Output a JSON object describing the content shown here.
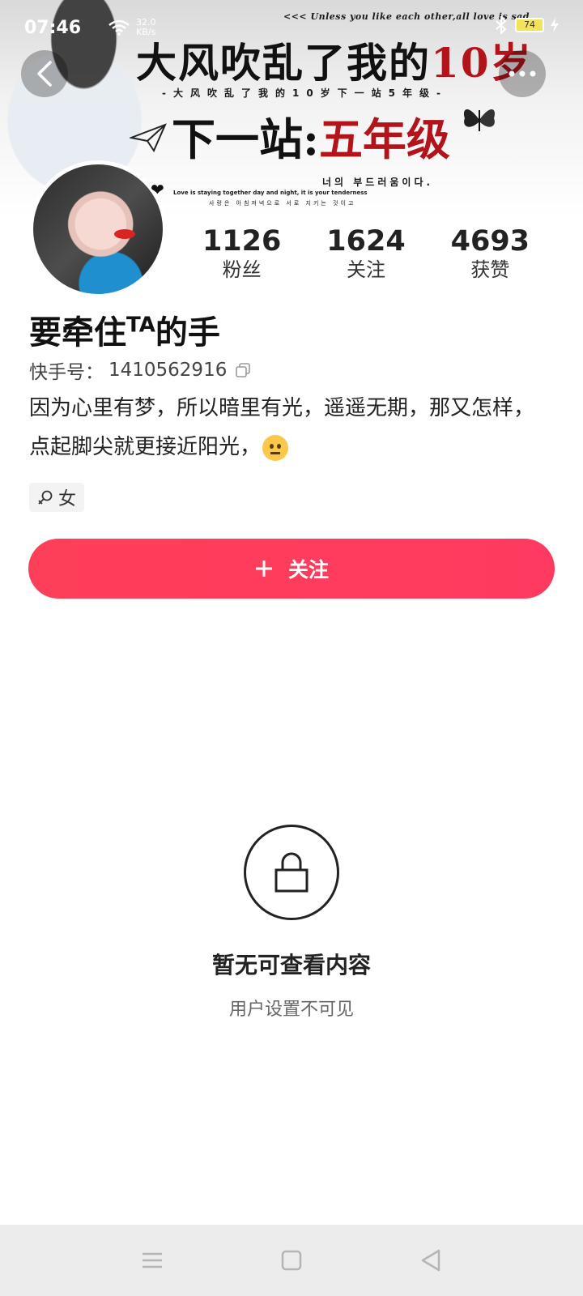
{
  "status_bar": {
    "time": "07:46",
    "net_speed_value": "32.0",
    "net_speed_unit": "KB/s",
    "battery": "74"
  },
  "banner": {
    "top_english": "<<<  Unless you like each other,all love is sad",
    "title_line1_black": "大风吹乱了我的",
    "title_line1_red": "10岁",
    "subtitle": "-大风吹乱了我的10岁下一站5年级-",
    "title_line2_black": "下一站:",
    "title_line2_red": "五年级",
    "korean_line": "너의 부드러움이다.",
    "english_line2": "Love is staying together day and night, it is your tenderness",
    "korean_line2": "사랑은 아침저녁으로 서로 지키는 것이고"
  },
  "profile": {
    "stats": [
      {
        "value": "1126",
        "label": "粉丝"
      },
      {
        "value": "1624",
        "label": "关注"
      },
      {
        "value": "4693",
        "label": "获赞"
      }
    ],
    "nickname_part1": "要牵住",
    "nickname_sup": "TA",
    "nickname_part2": "的手",
    "kid_label": "快手号：",
    "kid_value": "1410562916",
    "bio_line1": "因为心里有梦，所以暗里有光，遥遥无期，那又怎样，",
    "bio_line2": "点起脚尖就更接近阳光，",
    "gender": "女"
  },
  "follow_button": {
    "label": "关注",
    "color": "#fe3f59"
  },
  "empty_state": {
    "title": "暂无可查看内容",
    "subtitle": "用户设置不可见"
  }
}
